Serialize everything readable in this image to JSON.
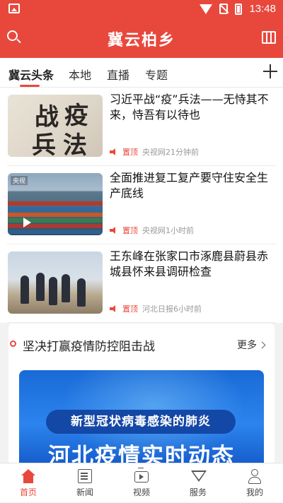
{
  "status_bar": {
    "time": "13:48"
  },
  "header": {
    "title": "冀云柏乡"
  },
  "tabs": [
    {
      "label": "冀云头条",
      "active": true
    },
    {
      "label": "本地"
    },
    {
      "label": "直播"
    },
    {
      "label": "专题"
    }
  ],
  "news": [
    {
      "title": "习近平战“疫”兵法——无恃其不来，恃吾有以待也",
      "pin": "置顶",
      "source": "央视网21分钟前",
      "thumb_text": [
        "战",
        "疫",
        "兵",
        "法"
      ]
    },
    {
      "title": "全面推进复工复产要守住安全生产底线",
      "pin": "置顶",
      "source": "央视网1小时前",
      "thumb_tag": "央视"
    },
    {
      "title": "王东峰在张家口市涿鹿县蔚县赤城县怀来县调研检查",
      "pin": "置顶",
      "source": "河北日报6小时前"
    }
  ],
  "section": {
    "title": "坚决打赢疫情防控阻击战",
    "more": "更多",
    "banner_pill": "新型冠状病毒感染的肺炎",
    "banner_title": "河北疫情实时动态"
  },
  "bottom_nav": [
    {
      "label": "首页",
      "icon": "home-icon",
      "active": true
    },
    {
      "label": "新闻",
      "icon": "news-icon"
    },
    {
      "label": "视频",
      "icon": "video-icon"
    },
    {
      "label": "服务",
      "icon": "service-icon"
    },
    {
      "label": "我的",
      "icon": "profile-icon"
    }
  ],
  "colors": {
    "brand": "#e8483c",
    "text": "#111111",
    "meta": "#999999"
  }
}
